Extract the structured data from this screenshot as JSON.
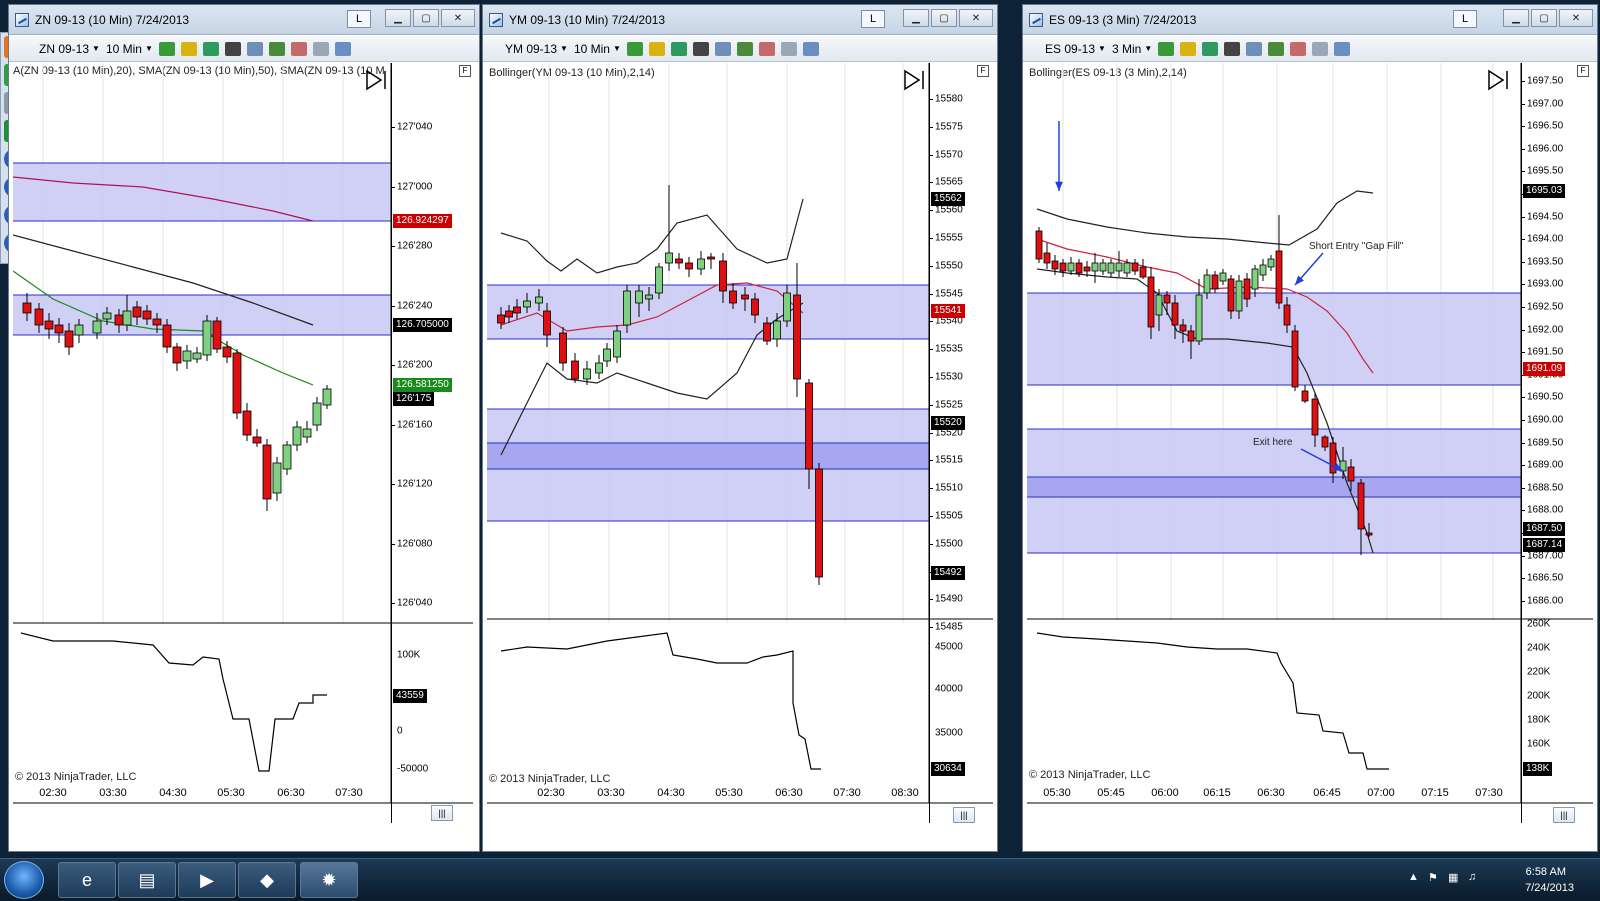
{
  "windows": [
    {
      "id": "zn",
      "title": "ZN 09-13 (10 Min)  7/24/2013",
      "instrument": "ZN 09-13",
      "interval": "10 Min",
      "lock_label": "L",
      "indicator_label": "A(ZN 09-13 (10 Min),20), SMA(ZN 09-13 (10 Min),50), SMA(ZN 09-13 (10 M",
      "y_labels": [
        "127'040",
        "127'000",
        "126'280",
        "126'240",
        "126'200",
        "126'160",
        "126'120",
        "126'080",
        "126'040"
      ],
      "price_tags": [
        {
          "text": "126.924297",
          "color": "#cc0000"
        },
        {
          "text": "126.705000",
          "color": "#000000"
        },
        {
          "text": "126.581250",
          "color": "#1a8a1a"
        },
        {
          "text": "126'175",
          "color": "#000000"
        }
      ],
      "volume_labels": [
        "100K",
        "0",
        "-50000"
      ],
      "volume_tag": "43559",
      "x_labels": [
        "02:30",
        "03:30",
        "04:30",
        "05:30",
        "06:30",
        "07:30"
      ],
      "copyright": "© 2013 NinjaTrader, LLC",
      "scroll_label": "|||"
    },
    {
      "id": "ym",
      "title": "YM 09-13 (10 Min)  7/24/2013",
      "instrument": "YM 09-13",
      "interval": "10 Min",
      "lock_label": "L",
      "indicator_label": "Bollinger(YM 09-13 (10 Min),2,14)",
      "y_labels": [
        "15580",
        "15575",
        "15570",
        "15565",
        "15560",
        "15555",
        "15550",
        "15545",
        "15540",
        "15535",
        "15530",
        "15525",
        "15520",
        "15515",
        "15510",
        "15505",
        "15500",
        "15495",
        "15490",
        "15485"
      ],
      "price_tags": [
        {
          "text": "15562",
          "color": "#000000"
        },
        {
          "text": "15541",
          "color": "#cc0000"
        },
        {
          "text": "15520",
          "color": "#000000"
        },
        {
          "text": "15492",
          "color": "#000000"
        }
      ],
      "volume_labels": [
        "45000",
        "40000",
        "35000"
      ],
      "volume_tag": "30634",
      "x_labels": [
        "02:30",
        "03:30",
        "04:30",
        "05:30",
        "06:30",
        "07:30",
        "08:30"
      ],
      "copyright": "© 2013 NinjaTrader, LLC",
      "scroll_label": "|||"
    },
    {
      "id": "es",
      "title": "ES 09-13 (3 Min)  7/24/2013",
      "instrument": "ES 09-13",
      "interval": "3 Min",
      "lock_label": "L",
      "indicator_label": "Bollinger(ES 09-13 (3 Min),2,14)",
      "y_labels": [
        "1697.50",
        "1697.00",
        "1696.50",
        "1696.00",
        "1695.50",
        "1695.00",
        "1694.50",
        "1694.00",
        "1693.50",
        "1693.00",
        "1692.50",
        "1692.00",
        "1691.50",
        "1691.00",
        "1690.50",
        "1690.00",
        "1689.50",
        "1689.00",
        "1688.50",
        "1688.00",
        "1687.50",
        "1687.00",
        "1686.50",
        "1686.00"
      ],
      "price_tags": [
        {
          "text": "1695.03",
          "color": "#000000"
        },
        {
          "text": "1691.09",
          "color": "#cc0000"
        },
        {
          "text": "1687.50",
          "color": "#000000"
        },
        {
          "text": "1687.14",
          "color": "#000000"
        }
      ],
      "volume_labels": [
        "260K",
        "240K",
        "220K",
        "200K",
        "180K",
        "160K"
      ],
      "volume_tag": "138K",
      "x_labels": [
        "05:30",
        "05:45",
        "06:00",
        "06:15",
        "06:30",
        "06:45",
        "07:00",
        "07:15",
        "07:30"
      ],
      "annotations": {
        "entry": "Short Entry \"Gap Fill\"",
        "exit": "Exit here"
      },
      "copyright": "© 2013 NinjaTrader, LLC",
      "scroll_label": "|||"
    }
  ],
  "taskbar": {
    "clock_time": "6:58 AM",
    "clock_date": "7/24/2013",
    "apps": [
      "internet-explorer",
      "file-explorer",
      "media-player",
      "ninjatrader",
      "settings-app"
    ]
  },
  "colors": {
    "zone_fill": "#c8c8f5",
    "zone_line": "#2c2cc8",
    "bull": "#7fd07f",
    "bear": "#dd1111"
  }
}
